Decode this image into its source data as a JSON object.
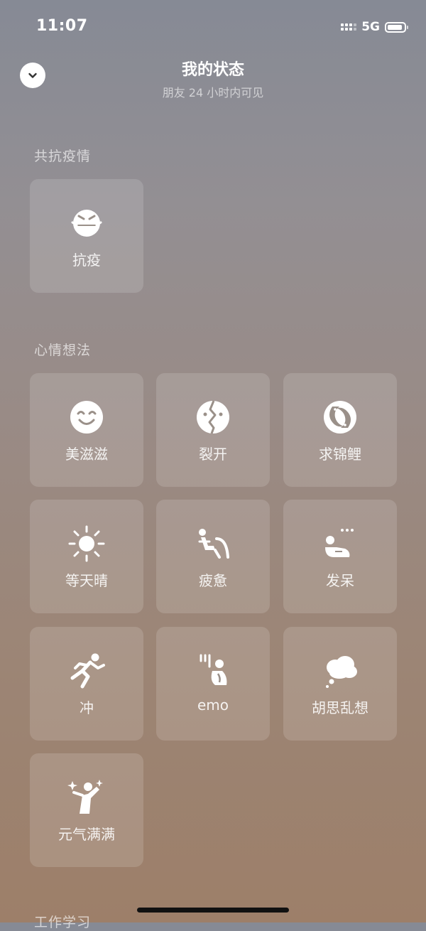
{
  "status_bar": {
    "time": "11:07",
    "network": "5G"
  },
  "header": {
    "title": "我的状态",
    "subtitle": "朋友 24 小时内可见"
  },
  "sections": [
    {
      "label": "共抗疫情",
      "items": [
        {
          "label": "抗疫",
          "icon": "mask-face-icon"
        }
      ]
    },
    {
      "label": "心情想法",
      "items": [
        {
          "label": "美滋滋",
          "icon": "smile-icon"
        },
        {
          "label": "裂开",
          "icon": "cracked-face-icon"
        },
        {
          "label": "求锦鲤",
          "icon": "koi-icon"
        },
        {
          "label": "等天晴",
          "icon": "sun-icon"
        },
        {
          "label": "疲惫",
          "icon": "tired-person-icon"
        },
        {
          "label": "发呆",
          "icon": "daze-person-icon"
        },
        {
          "label": "冲",
          "icon": "running-person-icon"
        },
        {
          "label": "emo",
          "icon": "emo-person-icon"
        },
        {
          "label": "胡思乱想",
          "icon": "thought-cloud-icon"
        },
        {
          "label": "元气满满",
          "icon": "energetic-person-icon"
        }
      ]
    },
    {
      "label": "工作学习"
    }
  ]
}
